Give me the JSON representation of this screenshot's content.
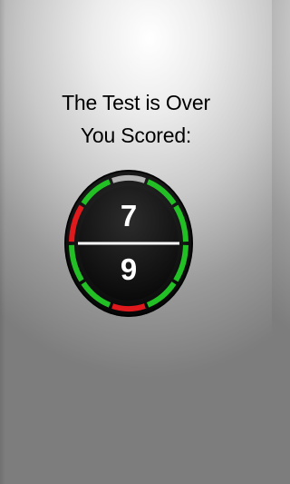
{
  "result": {
    "line1": "The Test is Over",
    "line2": "You Scored:"
  },
  "score": {
    "correct": "7",
    "total": "9",
    "fraction": 0.7778
  },
  "ring": {
    "segments": [
      {
        "status": "neutral"
      },
      {
        "status": "correct"
      },
      {
        "status": "correct"
      },
      {
        "status": "correct"
      },
      {
        "status": "correct"
      },
      {
        "status": "incorrect"
      },
      {
        "status": "correct"
      },
      {
        "status": "correct"
      },
      {
        "status": "incorrect"
      },
      {
        "status": "correct"
      }
    ]
  },
  "colors": {
    "correct": "#22c025",
    "incorrect": "#e0191c",
    "neutral": "#b4b4b4",
    "dial_face": "#161616",
    "text": "#000000",
    "score_text": "#ffffff"
  }
}
